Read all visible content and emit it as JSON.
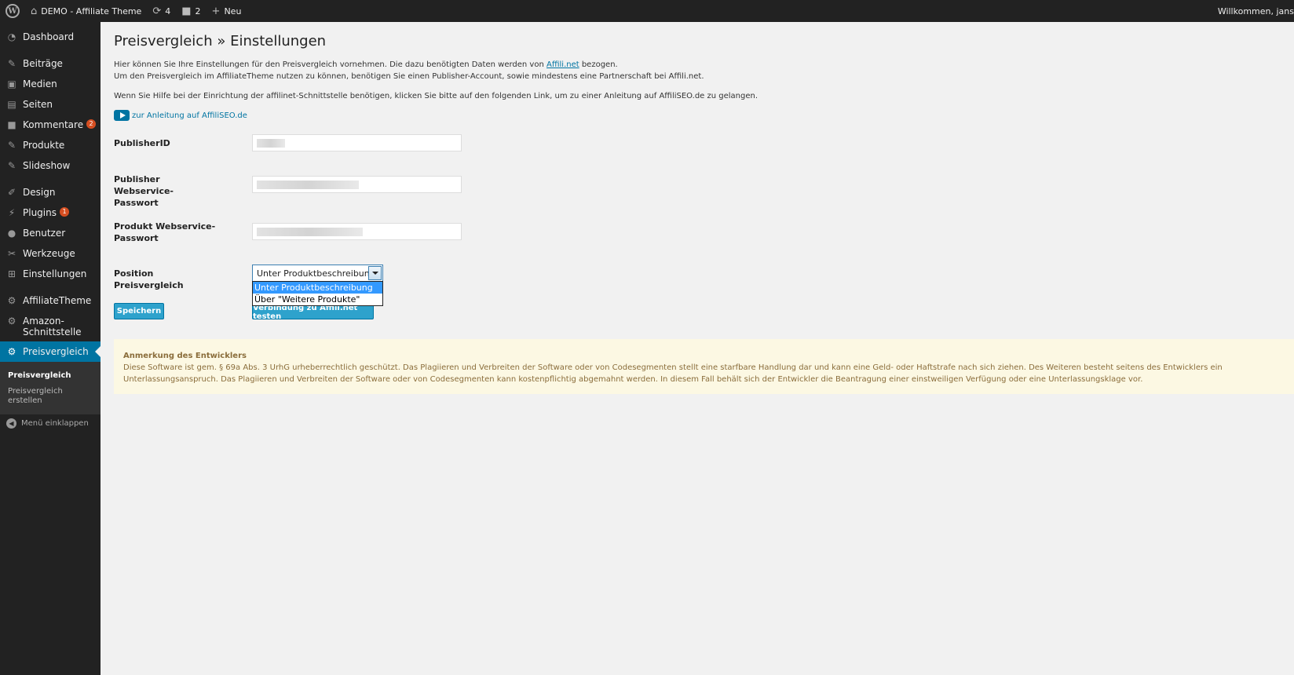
{
  "adminbar": {
    "site_name": "DEMO - Affiliate Theme",
    "updates_count": "4",
    "comments_count": "2",
    "new_label": "Neu",
    "welcome": "Willkommen, jans"
  },
  "sidebar": {
    "items": [
      {
        "label": "Dashboard",
        "icon": "dashboard-icon"
      },
      {
        "label": "Beiträge",
        "icon": "pin-icon"
      },
      {
        "label": "Medien",
        "icon": "media-icon"
      },
      {
        "label": "Seiten",
        "icon": "page-icon"
      },
      {
        "label": "Kommentare",
        "icon": "comment-icon",
        "badge": "2"
      },
      {
        "label": "Produkte",
        "icon": "pin-icon"
      },
      {
        "label": "Slideshow",
        "icon": "pin-icon"
      },
      {
        "label": "Design",
        "icon": "brush-icon"
      },
      {
        "label": "Plugins",
        "icon": "plugin-icon",
        "badge": "1"
      },
      {
        "label": "Benutzer",
        "icon": "user-icon"
      },
      {
        "label": "Werkzeuge",
        "icon": "wrench-icon"
      },
      {
        "label": "Einstellungen",
        "icon": "settings-icon"
      },
      {
        "label": "AffiliateTheme",
        "icon": "gear-icon"
      },
      {
        "label": "Amazon-Schnittstelle",
        "icon": "gear-icon"
      },
      {
        "label": "Preisvergleich",
        "icon": "gear-icon"
      }
    ],
    "submenu": {
      "current": "Preisvergleich",
      "create": "Preisvergleich erstellen"
    },
    "collapse_label": "Menü einklappen"
  },
  "page": {
    "title": "Preisvergleich » Einstellungen",
    "intro_line1_a": "Hier können Sie Ihre Einstellungen für den Preisvergleich vornehmen. Die dazu benötigten Daten werden von ",
    "intro_link": "Affili.net",
    "intro_line1_b": " bezogen.",
    "intro_line2": "Um den Preisvergleich im AffiliateTheme nutzen zu können, benötigen Sie einen Publisher-Account, sowie mindestens eine Partnerschaft bei Affili.net.",
    "intro_line3": "Wenn Sie Hilfe bei der Einrichtung der affilinet-Schnittstelle benötigen, klicken Sie bitte auf den folgenden Link, um zu einer Anleitung auf AffiliSEO.de zu gelangen.",
    "help_link": "zur Anleitung auf AffiliSEO.de"
  },
  "form": {
    "publisher_id_label": "PublisherID",
    "publisher_pw_label": "Publisher Webservice-Passwort",
    "product_pw_label": "Produkt Webservice-Passwort",
    "position_label": "Position Preisvergleich",
    "position_selected": "Unter Produktbeschreibung",
    "position_options": [
      "Unter Produktbeschreibung",
      "Über \"Weitere Produkte\""
    ],
    "save_button": "Speichern",
    "test_button": "Verbindung zu Affili.net testen"
  },
  "notice": {
    "title": "Anmerkung des Entwicklers",
    "text": "Diese Software ist gem. § 69a Abs. 3 UrhG urheberrechtlich geschützt. Das Plagiieren und Verbreiten der Software oder von Codesegmenten stellt eine starfbare Handlung dar und kann eine Geld- oder Haftstrafe nach sich ziehen. Des Weiteren besteht seitens des Entwicklers ein Unterlassungsanspruch. Das Plagiieren und Verbreiten der Software oder von Codesegmenten kann kostenpflichtig abgemahnt werden. In diesem Fall behält sich der Entwickler die Beantragung einer einstweiligen Verfügung oder eine Unterlassungsklage vor."
  },
  "colors": {
    "accent": "#0074a2",
    "button": "#2ea2cc",
    "sidebar": "#222222",
    "notice_bg": "#fcf8e3",
    "notice_text": "#8a6d3b"
  }
}
